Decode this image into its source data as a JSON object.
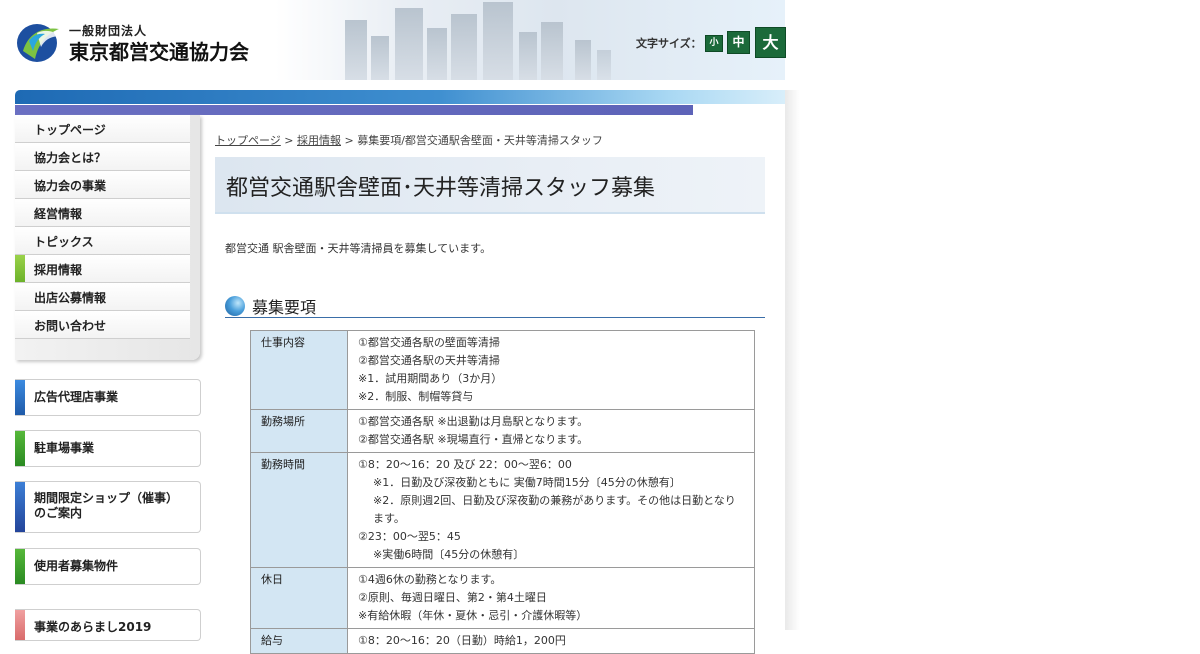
{
  "header": {
    "org_small": "一般財団法人",
    "org_name": "東京都営交通協力会",
    "fontsize_label": "文字サイズ：",
    "fontsize_small": "小",
    "fontsize_mid": "中",
    "fontsize_large": "大"
  },
  "nav": {
    "items": [
      {
        "label": "トップページ"
      },
      {
        "label": "協力会とは？"
      },
      {
        "label": "協力会の事業"
      },
      {
        "label": "経営情報"
      },
      {
        "label": "トピックス"
      },
      {
        "label": "採用情報",
        "active": true
      },
      {
        "label": "出店公募情報"
      },
      {
        "label": "お問い合わせ"
      }
    ]
  },
  "banners": [
    {
      "label": "広告代理店事業",
      "color": "#2a6fc0"
    },
    {
      "label": "駐車場事業",
      "color": "#3b9a2c"
    },
    {
      "label_line1": "期間限定ショップ（催事）",
      "label_line2": "のご案内",
      "color": "#2a55b0"
    },
    {
      "label": "使用者募集物件",
      "color": "#3b9a2c"
    },
    {
      "label": "事業のあらまし2019",
      "color": "#e07a7a"
    }
  ],
  "breadcrumb": {
    "top": "トップページ",
    "sep1": " > ",
    "recruit": "採用情報",
    "sep2": " > ",
    "current": "募集要項/都営交通駅舎壁面・天井等清掃スタッフ"
  },
  "page": {
    "title": "都営交通駅舎壁面･天井等清掃スタッフ募集",
    "intro": "都営交通 駅舎壁面・天井等清掃員を募集しています。",
    "section_title": "募集要項"
  },
  "requirements": {
    "job": {
      "label": "仕事内容",
      "l1": "①都営交通各駅の壁面等清掃",
      "l2": "②都営交通各駅の天井等清掃",
      "l3": "※1．試用期間あり（3か月）",
      "l4": "※2．制服、制帽等貸与"
    },
    "place": {
      "label": "勤務場所",
      "l1": "①都営交通各駅 ※出退勤は月島駅となります。",
      "l2": "②都営交通各駅 ※現場直行・直帰となります。"
    },
    "hours": {
      "label": "勤務時間",
      "l1": "①8：20～16：20 及び 22：00～翌6：00",
      "l2": "※1．日勤及び深夜勤ともに 実働7時間15分〔45分の休憩有〕",
      "l3": "※2．原則週2回、日勤及び深夜勤の兼務があります。その他は日勤となります。",
      "l4": "②23：00～翌5：45",
      "l5": "※実働6時間〔45分の休憩有〕"
    },
    "holiday": {
      "label": "休日",
      "l1": "①4週6休の勤務となります。",
      "l2": "②原則、毎週日曜日、第2・第4土曜日",
      "l3": "※有給休暇（年休・夏休・忌引・介護休暇等）"
    },
    "salary": {
      "label": "給与",
      "l1": "①8：20～16：20（日勤）時給1，200円"
    }
  }
}
